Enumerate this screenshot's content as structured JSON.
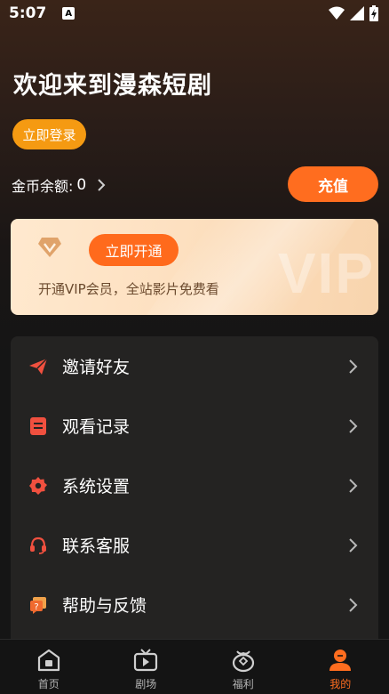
{
  "status": {
    "time": "5:07",
    "a_badge": "A"
  },
  "header": {
    "welcome": "欢迎来到漫森短剧",
    "login_label": "立即登录"
  },
  "coins": {
    "label": "金币余额:",
    "value": "0",
    "recharge_label": "充值"
  },
  "vip": {
    "open_label": "立即开通",
    "description": "开通VIP会员，全站影片免费看",
    "watermark": "VIP"
  },
  "menu": [
    {
      "label": "邀请好友",
      "icon": "paper-plane-icon"
    },
    {
      "label": "观看记录",
      "icon": "history-doc-icon"
    },
    {
      "label": "系统设置",
      "icon": "gear-icon"
    },
    {
      "label": "联系客服",
      "icon": "headset-icon"
    },
    {
      "label": "帮助与反馈",
      "icon": "feedback-icon"
    }
  ],
  "tabs": [
    {
      "label": "首页",
      "icon": "home-icon"
    },
    {
      "label": "剧场",
      "icon": "tv-icon"
    },
    {
      "label": "福利",
      "icon": "gift-bag-icon"
    },
    {
      "label": "我的",
      "icon": "user-icon",
      "active": true
    }
  ],
  "colors": {
    "accent": "#ff6d1f",
    "login": "#f59a12",
    "icon_red": "#f0503f"
  }
}
